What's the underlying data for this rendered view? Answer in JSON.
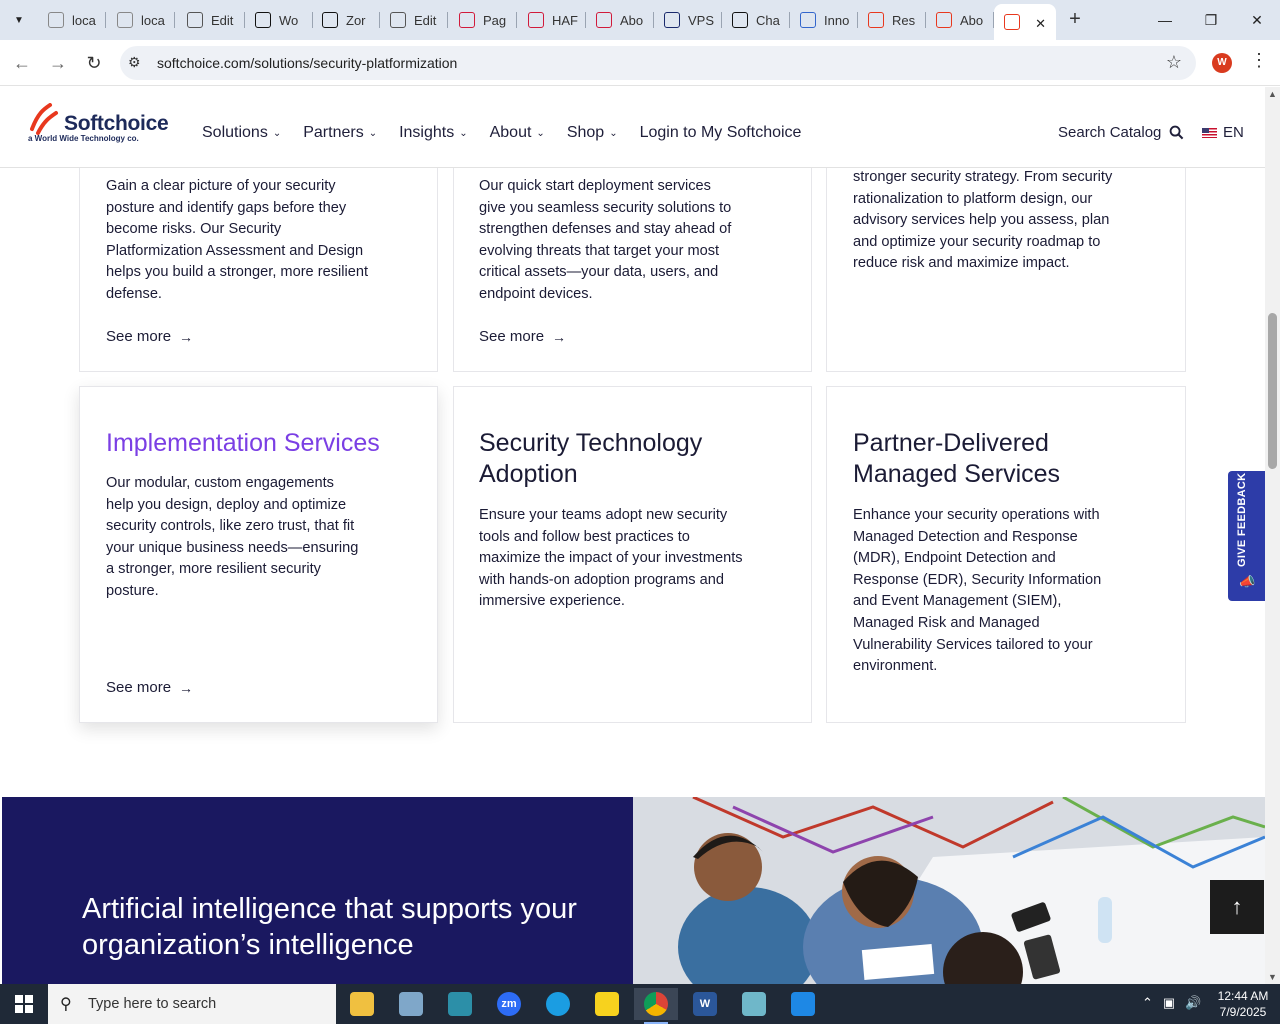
{
  "browser": {
    "tabs": [
      {
        "title": "loca",
        "favicon": "generic-page-icon",
        "color": "#888"
      },
      {
        "title": "loca",
        "favicon": "generic-page-icon",
        "color": "#888"
      },
      {
        "title": "Edit",
        "favicon": "globe-icon",
        "color": "#555"
      },
      {
        "title": "Wo",
        "favicon": "chatgpt-icon",
        "color": "#111"
      },
      {
        "title": "Zor",
        "favicon": "zoho-icon",
        "color": "#111"
      },
      {
        "title": "Edit",
        "favicon": "globe-icon",
        "color": "#555"
      },
      {
        "title": "Pag",
        "favicon": "diamond-icon",
        "color": "#d11a3b"
      },
      {
        "title": "HAF",
        "favicon": "diamond-icon",
        "color": "#d11a3b"
      },
      {
        "title": "Abo",
        "favicon": "diamond-icon",
        "color": "#d11a3b"
      },
      {
        "title": "VPS",
        "favicon": "vps-icon",
        "color": "#1a2a6c"
      },
      {
        "title": "Cha",
        "favicon": "chatgpt-icon",
        "color": "#111"
      },
      {
        "title": "Inno",
        "favicon": "inno-icon",
        "color": "#3366cc"
      },
      {
        "title": "Res",
        "favicon": "softchoice-icon",
        "color": "#e8381e"
      },
      {
        "title": "Abo",
        "favicon": "softchoice-icon",
        "color": "#e8381e"
      },
      {
        "title": "",
        "favicon": "softchoice-icon",
        "color": "#e8381e",
        "active": true
      }
    ],
    "url": "softchoice.com/solutions/security-platformization",
    "profile_initial": "W"
  },
  "site": {
    "logo_name": "Softchoice",
    "logo_tag": "a World Wide Technology co.",
    "nav": [
      "Solutions",
      "Partners",
      "Insights",
      "About",
      "Shop"
    ],
    "login": "Login to My Softchoice",
    "search_catalog": "Search Catalog",
    "language": "EN"
  },
  "cards_top": [
    {
      "body": "Gain a clear picture of your security posture and identify gaps before they become risks. Our Security Platformization Assessment and Design helps you build a stronger, more resilient defense.",
      "link": "See more"
    },
    {
      "body": "Our quick start deployment services give you seamless security solutions to strengthen defenses and stay ahead of evolving threats that target your most critical assets—your data, users, and endpoint devices.",
      "link": "See more"
    },
    {
      "body": "stronger security strategy. From security rationalization to platform design, our advisory services help you assess, plan and optimize your security roadmap to reduce risk and maximize impact.",
      "link": ""
    }
  ],
  "cards_bottom": [
    {
      "title": "Implementation Services",
      "body": "Our modular, custom engagements help you design, deploy and optimize security controls, like zero trust, that fit your unique business needs—ensuring a stronger, more resilient security posture.",
      "link": "See more"
    },
    {
      "title": "Security Technology Adoption",
      "body": "Ensure your teams adopt new security tools and follow best practices to maximize the impact of your investments with hands-on adoption programs and immersive experience.",
      "link": ""
    },
    {
      "title": "Partner-Delivered Managed Services",
      "body": "Enhance your security operations with Managed Detection and Response (MDR), Endpoint Detection and Response (EDR), Security Information and Event Management (SIEM), Managed Risk and Managed Vulnerability Services tailored to your environment.",
      "link": ""
    }
  ],
  "feedback": "GIVE FEEDBACK",
  "ai_banner": {
    "heading": "Artificial intelligence that supports your organization’s intelligence"
  },
  "taskbar": {
    "search_placeholder": "Type here to search",
    "time": "12:44 AM",
    "date": "7/9/2025"
  },
  "colors": {
    "accent_purple": "#7b3fe4",
    "navy": "#1a1860",
    "brand_red": "#e8381e"
  }
}
